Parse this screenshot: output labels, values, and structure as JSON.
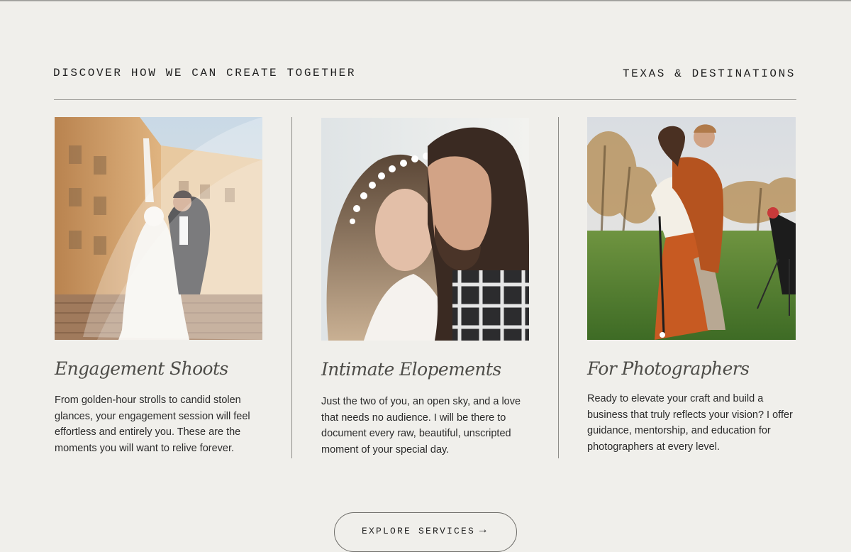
{
  "header": {
    "eyebrow_left": "DISCOVER HOW WE CAN CREATE TOGETHER",
    "eyebrow_right": "TEXAS & DESTINATIONS"
  },
  "cards": [
    {
      "title": "Engagement Shoots",
      "text": "From golden-hour strolls to candid stolen glances, your engagement session will feel effortless and entirely you. These are the moments you will want to relive forever.",
      "photo_icon": "couple-veil-photo"
    },
    {
      "title": "Intimate Elopements",
      "text": "Just the two of you, an open sky, and a love that needs no audience. I will be there to document every raw, beautiful, unscripted moment of your special day.",
      "photo_icon": "couple-kiss-photo"
    },
    {
      "title": "For Photographers",
      "text": "Ready to elevate your craft and build a business that truly reflects your vision? I offer guidance, mentorship, and education for photographers at every level.",
      "photo_icon": "couple-golf-photo"
    }
  ],
  "cta": {
    "label": "EXPLORE SERVICES",
    "arrow_icon": "arrow-right-icon"
  },
  "colors": {
    "background": "#f0efeb",
    "rule": "#9b9a96",
    "title": "#4d4c48",
    "body_text": "#2a2a2a"
  }
}
